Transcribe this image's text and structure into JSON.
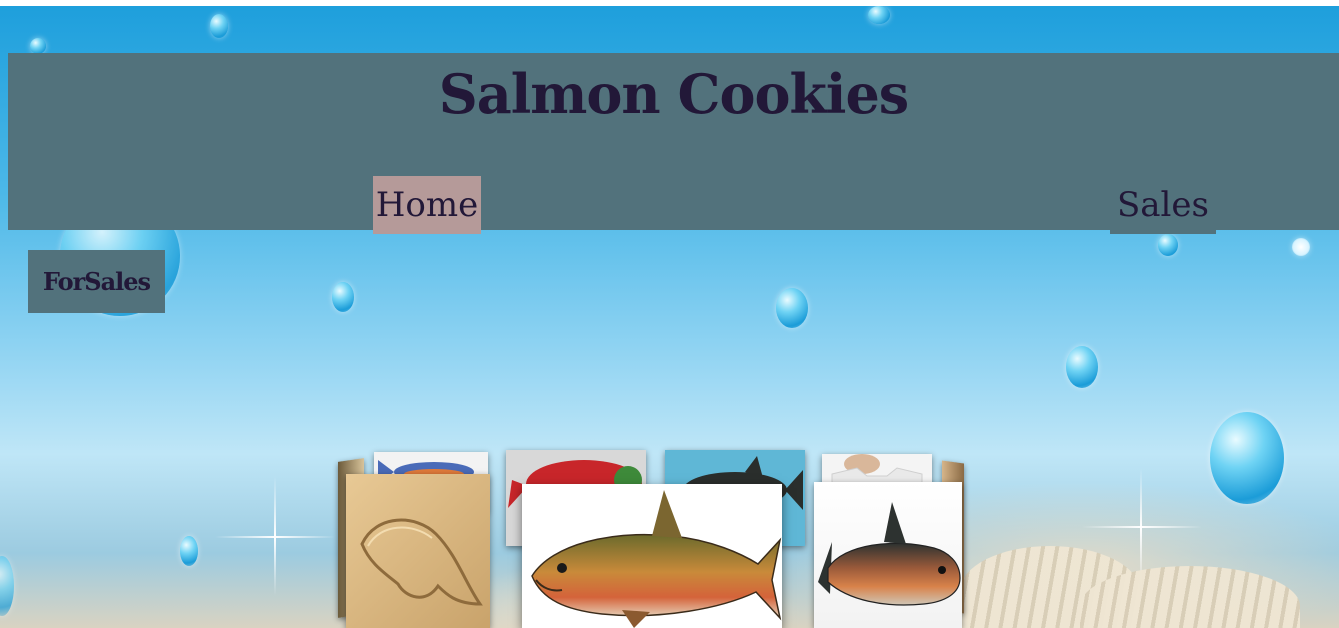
{
  "header": {
    "title": "Salmon Cookies"
  },
  "nav": {
    "home_label": "Home",
    "sales_label": "Sales"
  },
  "sidebar": {
    "forsales_label": "ForSales"
  },
  "colors": {
    "header_bg": "#52727c",
    "home_active_bg": "#b59a99",
    "text": "#221838"
  },
  "gallery": {
    "images": [
      {
        "name": "wooden-salmon-cutout-image"
      },
      {
        "name": "fish-drawing-image"
      },
      {
        "name": "red-salmon-image"
      },
      {
        "name": "chinook-salmon-featured-image"
      },
      {
        "name": "salmon-on-blue-image"
      },
      {
        "name": "salmon-tshirt-image"
      },
      {
        "name": "king-salmon-image"
      }
    ]
  }
}
